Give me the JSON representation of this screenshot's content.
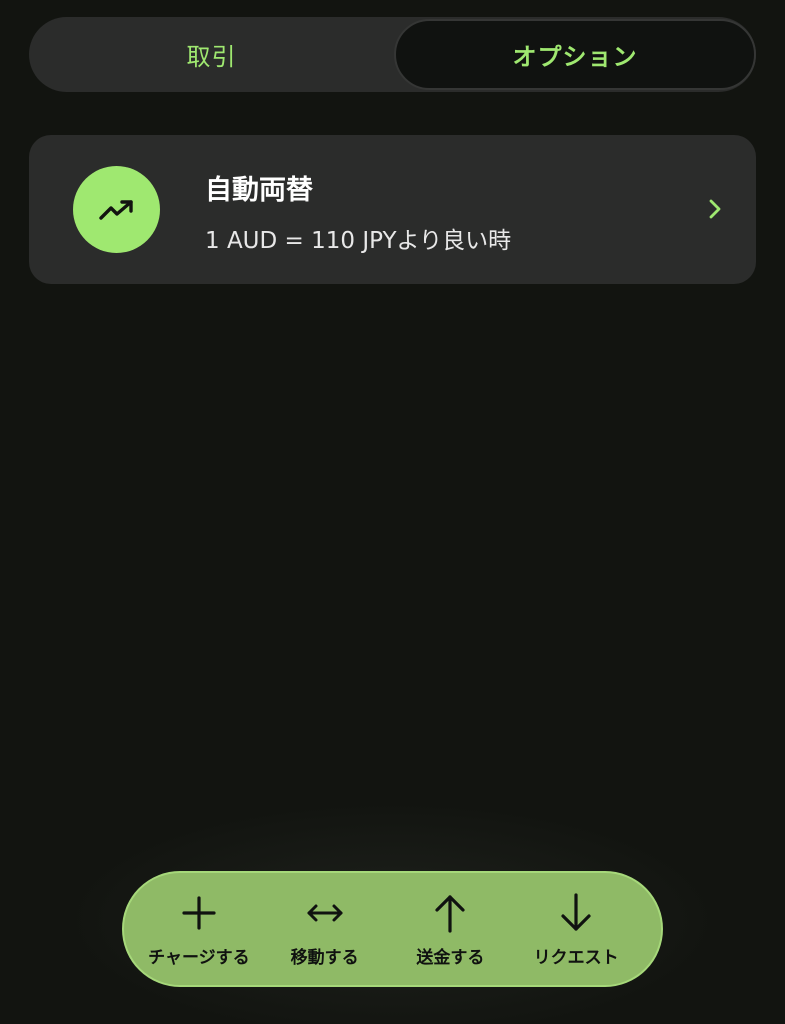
{
  "tabs": [
    {
      "label": "取引",
      "active": false
    },
    {
      "label": "オプション",
      "active": true
    }
  ],
  "auto_exchange": {
    "title": "自動両替",
    "subtitle": "1 AUD = 110 JPYより良い時",
    "icon": "trending-up-icon"
  },
  "actions": [
    {
      "label": "チャージする",
      "icon": "plus-icon"
    },
    {
      "label": "移動する",
      "icon": "swap-horizontal-icon"
    },
    {
      "label": "送金する",
      "icon": "arrow-up-icon"
    },
    {
      "label": "リクエスト",
      "icon": "arrow-down-icon"
    }
  ],
  "colors": {
    "background": "#121410",
    "card": "#2b2c2b",
    "accent": "#9fe870",
    "action_bar": "#8fba66"
  }
}
